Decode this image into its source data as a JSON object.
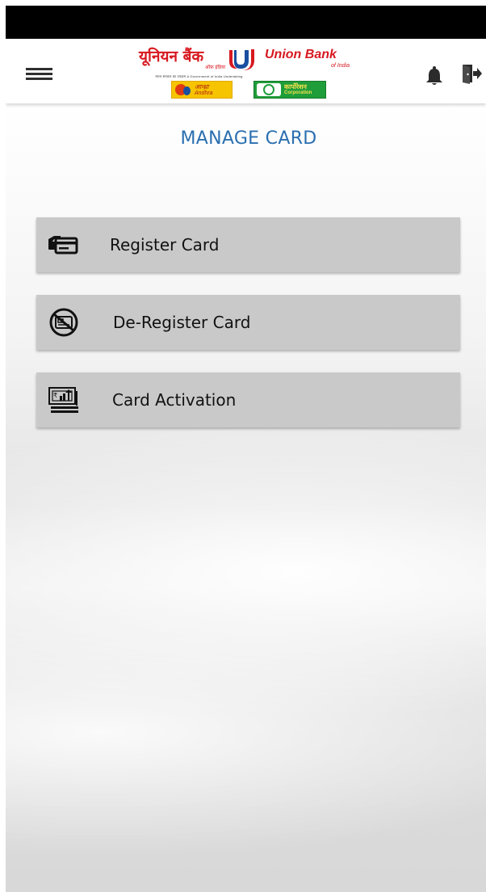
{
  "header": {
    "logo_hindi": "यूनियन बैंक",
    "logo_hindi_sub": "ऑफ़ इंडिया",
    "logo_english": "Union Bank",
    "logo_english_sub": "of India",
    "logo_tagline": "भारत सरकार का उपक्रम   A Government of India Undertaking",
    "badge_andhra_hindi": "आन्ध्रा",
    "badge_andhra_english": "Andhra",
    "badge_corporation_hindi": "कार्पोरेशन",
    "badge_corporation_english": "Corporation",
    "brand_color": "#d71920"
  },
  "page": {
    "title": "MANAGE CARD",
    "title_color": "#2a6fb0"
  },
  "menu": {
    "items": [
      {
        "label": "Register Card",
        "icon": "register-card-icon"
      },
      {
        "label": "De-Register Card",
        "icon": "deregister-card-icon"
      },
      {
        "label": "Card Activation",
        "icon": "card-activation-icon"
      }
    ]
  },
  "icons": {
    "menu": "hamburger-menu-icon",
    "notifications": "bell-icon",
    "logout": "logout-icon"
  }
}
